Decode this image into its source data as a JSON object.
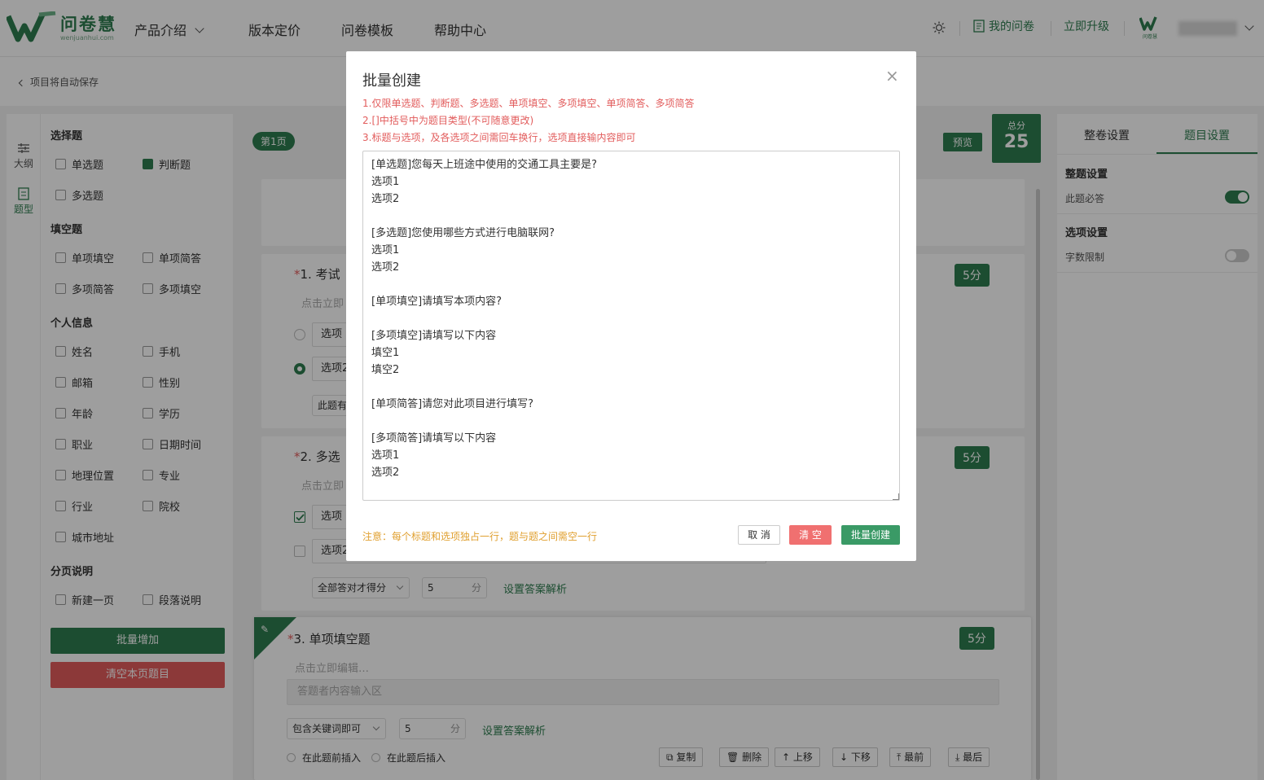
{
  "brand": {
    "name_cn": "问卷慧",
    "name_en": "wenjuanhui.com",
    "mini_name": "问卷慧"
  },
  "nav": {
    "items": [
      "产品介绍",
      "版本定价",
      "问卷模板",
      "帮助中心"
    ]
  },
  "header_right": {
    "my_surveys": "我的问卷",
    "upgrade": "立即升级"
  },
  "subbar": {
    "back_text": "项目将自动保存"
  },
  "rail": {
    "outline": "大纲",
    "types": "题型"
  },
  "palette": {
    "choice_head": "选择题",
    "choice": [
      "单选题",
      "判断题",
      "多选题"
    ],
    "fill_head": "填空题",
    "fill": [
      "单项填空",
      "单项简答",
      "多项简答",
      "多项填空"
    ],
    "info_head": "个人信息",
    "info": [
      "姓名",
      "手机",
      "邮箱",
      "性别",
      "年龄",
      "学历",
      "职业",
      "日期时间",
      "地理位置",
      "专业",
      "行业",
      "院校",
      "城市地址"
    ],
    "page_head": "分页说明",
    "page": [
      "新建一页",
      "段落说明"
    ],
    "batch_add": "批量增加",
    "clear_page": "清空本页题目"
  },
  "editor_area": {
    "page_badge": "第1页",
    "preview": "预览",
    "total_label": "总分",
    "total_value": "25",
    "q1": {
      "num": "1.",
      "title": "考试",
      "score": "5分",
      "hint": "点击立即",
      "opt1": "选项",
      "opt2": "选项2",
      "extra": "此题有"
    },
    "q2": {
      "num": "2.",
      "title": "多选",
      "score": "5分",
      "hint": "点击立即",
      "opt1": "选项",
      "opt2": "选项2",
      "rule": "全部答对才得分",
      "score_val": "5",
      "unit": "分",
      "analysis": "设置答案解析"
    },
    "q3": {
      "num": "3.",
      "title": "单项填空题",
      "score": "5分",
      "hint": "点击立即编辑…",
      "answer": "答题者内容输入区",
      "rule": "包含关键词即可",
      "score_val": "5",
      "unit": "分",
      "analysis": "设置答案解析",
      "insert_before": "在此题前插入",
      "insert_after": "在此题后插入"
    },
    "actions": [
      "复制",
      "删除",
      "上移",
      "下移",
      "最前",
      "最后"
    ]
  },
  "right_panel": {
    "tab_survey": "整卷设置",
    "tab_question": "题目设置",
    "section1": "整题设置",
    "required": "此题必答",
    "required_on": true,
    "section2": "选项设置",
    "word_limit": "字数限制",
    "word_limit_on": false
  },
  "modal": {
    "title": "批量创建",
    "close": "×",
    "rules": [
      "1.仅限单选题、判断题、多选题、单项填空、多项填空、单项简答、多项简答",
      "2.[]中括号中为题目类型(不可随意更改)",
      "3.标题与选项，及各选项之间需回车换行，选项直接输内容即可"
    ],
    "content": "[单选题]您每天上班途中使用的交通工具主要是?\n选项1\n选项2\n\n[多选题]您使用哪些方式进行电脑联网?\n选项1\n选项2\n\n[单项填空]请填写本项内容?\n\n[多项填空]请填写以下内容\n填空1\n填空2\n\n[单项简答]请您对此项目进行填写?\n\n[多项简答]请填写以下内容\n选项1\n选项2",
    "note": "注意：每个标题和选项独占一行，题与题之间需空一行",
    "cancel": "取 消",
    "clear": "清 空",
    "create": "批量创建"
  },
  "colors": {
    "brand_green": "#2e7d4f",
    "danger_red": "#e25c5c",
    "note_orange": "#e0a030"
  }
}
